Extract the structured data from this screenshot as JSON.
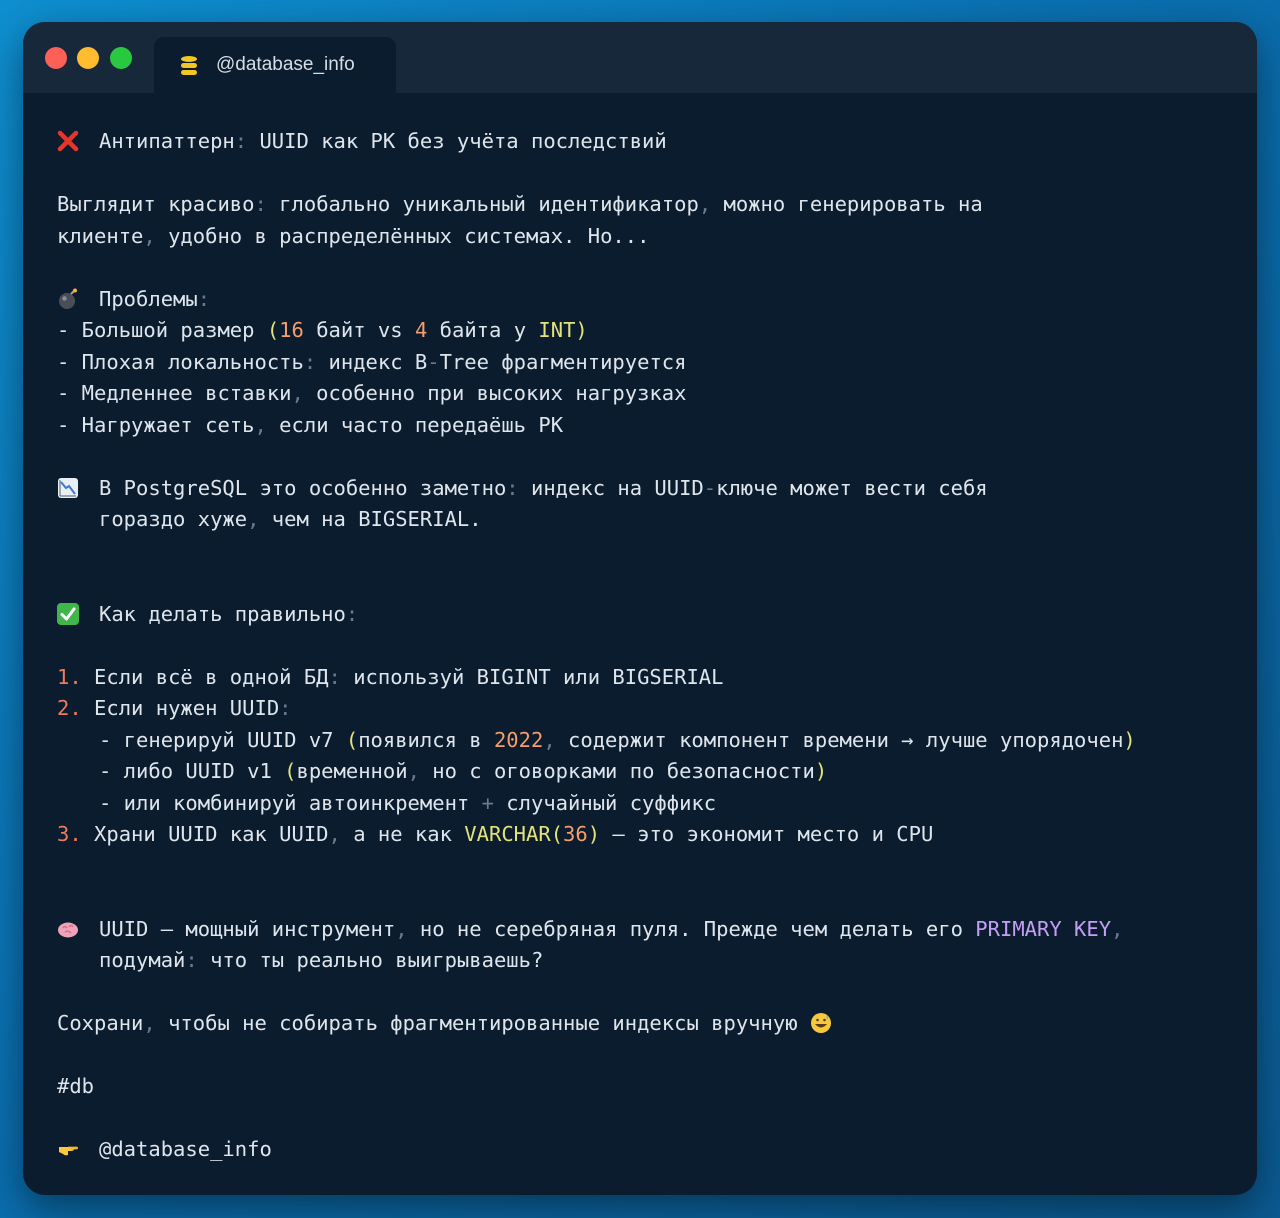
{
  "window": {
    "tab_title": "@database_info",
    "tab_icon": "database-icon",
    "traffic_lights": {
      "close": "#fe5f57",
      "minimize": "#febc2e",
      "zoom": "#28c840"
    }
  },
  "post": {
    "heading": {
      "icon": "cross-mark-icon",
      "text": "Антипаттерн: UUID как PK без учёта последствий"
    },
    "intro": [
      "Выглядит красиво: глобально уникальный идентификатор, можно генерировать на",
      "клиенте, удобно в распределённых системах. Но..."
    ],
    "problems": {
      "icon": "bomb-icon",
      "title": "Проблемы:",
      "items": [
        "- Большой размер (16 байт vs 4 байта у INT)",
        "- Плохая локальность: индекс B-Tree фрагментируется",
        "- Медленнее вставки, особенно при высоких нагрузках",
        "- Нагружает сеть, если часто передаёшь PK"
      ]
    },
    "postgres_note": {
      "icon": "chart-decreasing-icon",
      "lines": [
        "В PostgreSQL это особенно заметно: индекс на UUID-ключе может вести себя",
        "гораздо хуже, чем на BIGSERIAL."
      ]
    },
    "howto": {
      "icon": "check-mark-icon",
      "title": "Как делать правильно:",
      "steps": [
        "1. Если всё в одной БД: используй BIGINT или BIGSERIAL",
        "2. Если нужен UUID:",
        "- генерируй UUID v7 (появился в 2022, содержит компонент времени → лучше упорядочен)",
        "- либо UUID v1 (временной, но с оговорками по безопасности)",
        "- или комбинируй автоинкремент + случайный суффикс",
        "3. Храни UUID как UUID, а не как VARCHAR(36) — это экономит место и CPU"
      ]
    },
    "conclusion": {
      "icon": "brain-icon",
      "lines": [
        "UUID — мощный инструмент, но не серебряная пуля. Прежде чем делать его PRIMARY KEY,",
        "подумай: что ты реально выигрываешь?"
      ]
    },
    "save_text": "Сохрани, чтобы не собирать фрагментированные индексы вручную",
    "save_icon": "grinning-sweat-icon",
    "hashtag": "#db",
    "footer": {
      "icon": "pointing-right-icon",
      "handle": "@database_info"
    }
  }
}
